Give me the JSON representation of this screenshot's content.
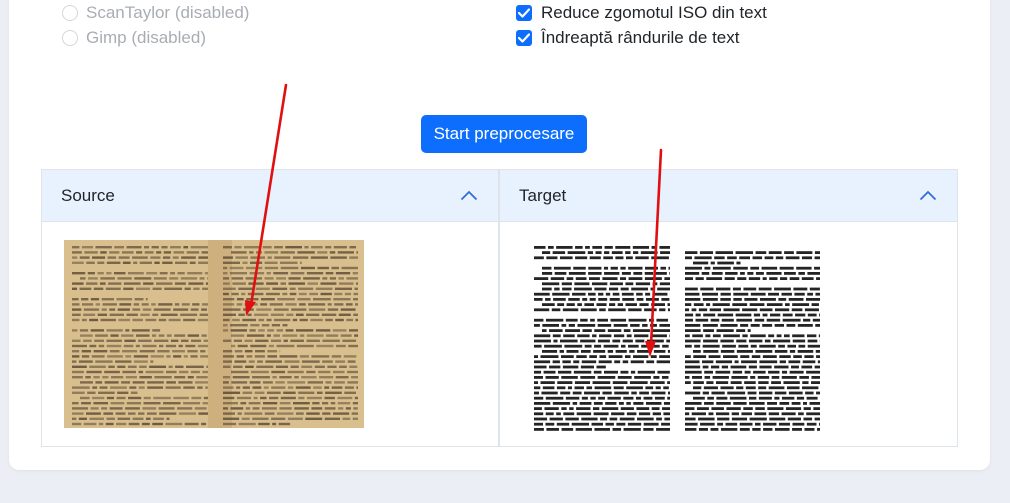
{
  "options": {
    "left": [
      {
        "label": "ScanTaylor (disabled)",
        "checked": false,
        "disabled": true
      },
      {
        "label": "Gimp (disabled)",
        "checked": false,
        "disabled": true
      }
    ],
    "right": [
      {
        "label": "Reduce zgomotul ISO din text",
        "checked": true
      },
      {
        "label": "Îndreaptă rândurile de text",
        "checked": true
      }
    ]
  },
  "start_button": "Start preprocesare",
  "panels": {
    "source": {
      "title": "Source",
      "icon": "chevron-up-icon"
    },
    "target": {
      "title": "Target",
      "icon": "chevron-up-icon"
    }
  },
  "colors": {
    "accent": "#0d6efd",
    "panel_header": "#e8f1fe",
    "annotation_arrow": "#e01010",
    "source_paper": "#d9bf8e",
    "target_paper": "#ffffff"
  }
}
